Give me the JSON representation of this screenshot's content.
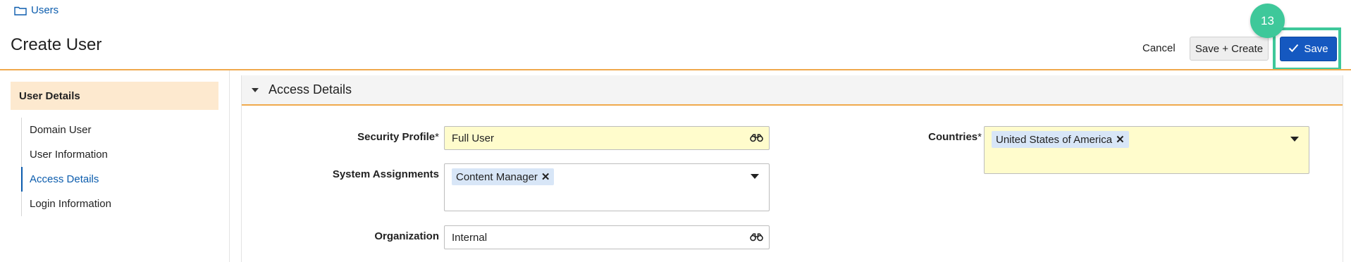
{
  "breadcrumb": {
    "label": "Users",
    "icon": "folder-icon"
  },
  "page_title": "Create User",
  "actions": {
    "cancel_label": "Cancel",
    "save_create_label": "Save + Create",
    "save_label": "Save",
    "save_icon": "checkmark-icon"
  },
  "step_badge": "13",
  "colors": {
    "accent_orange": "#f0a94c",
    "primary_blue": "#1558c0",
    "highlight_green": "#3ec89a",
    "required_yellow": "#fffccc",
    "chip_blue": "#d8e6f7",
    "nav_header_bg": "#fde9cf"
  },
  "sidebar": {
    "header": "User Details",
    "items": [
      {
        "label": "Domain User",
        "active": false
      },
      {
        "label": "User Information",
        "active": false
      },
      {
        "label": "Access Details",
        "active": true
      },
      {
        "label": "Login Information",
        "active": false
      }
    ]
  },
  "section": {
    "title": "Access Details",
    "fields": {
      "security_profile": {
        "label": "Security Profile",
        "required_mark": "*",
        "value": "Full User",
        "icon": "binoculars-icon"
      },
      "system_assignments": {
        "label": "System Assignments",
        "chips": [
          "Content Manager"
        ]
      },
      "organization": {
        "label": "Organization",
        "value": "Internal",
        "icon": "binoculars-icon"
      },
      "countries": {
        "label": "Countries",
        "required_mark": "*",
        "chips": [
          "United States of America"
        ]
      }
    }
  }
}
